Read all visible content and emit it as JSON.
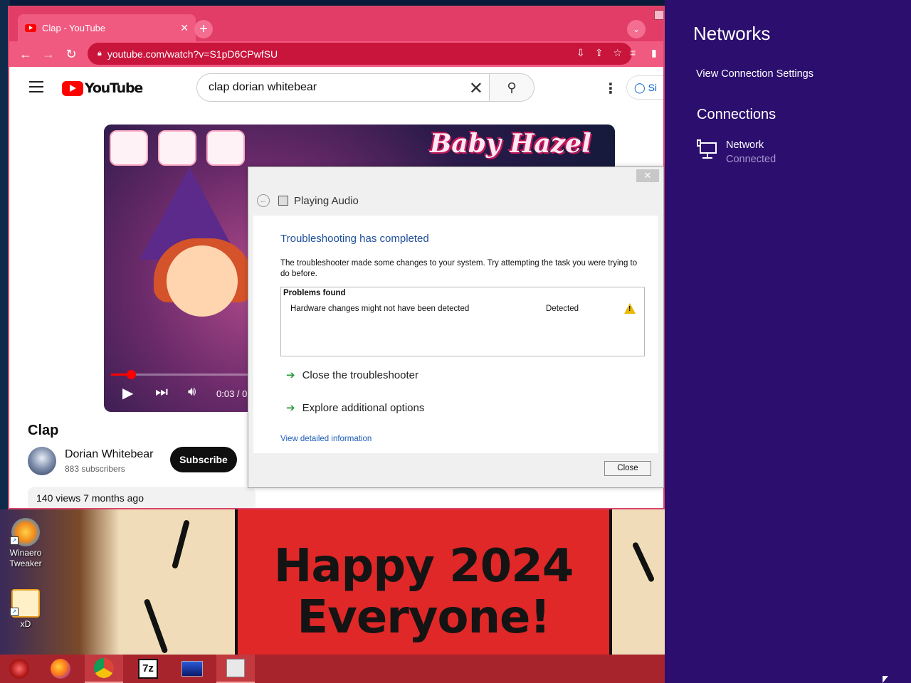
{
  "desktop": {
    "icons": [
      {
        "label_line1": "Winaero",
        "label_line2": "Tweaker"
      },
      {
        "label_line1": "xD",
        "label_line2": ""
      }
    ],
    "wallpaper_text_line1": "Happy 2024",
    "wallpaper_text_line2": "Everyone!"
  },
  "browser": {
    "tab_title": "Clap - YouTube",
    "tab_close": "✕",
    "new_tab": "+",
    "url": "youtube.com/watch?v=S1pD6CPwfSU",
    "youtube": {
      "logo_text": "YouTube",
      "search_value": "clap dorian whitebear",
      "signin_label": "Si",
      "player": {
        "game_title": "Baby Hazel",
        "time": "0:03 / 0"
      },
      "video_title": "Clap",
      "channel_name": "Dorian Whitebear",
      "subscribers": "883 subscribers",
      "subscribe_label": "Subscribe",
      "views": "140 views  7 months ago"
    }
  },
  "dialog": {
    "nav_title": "Playing Audio",
    "heading": "Troubleshooting has completed",
    "message": "The troubleshooter made some changes to your system. Try attempting the task you were trying to do before.",
    "problems_header": "Problems found",
    "problem_name": "Hardware changes might not have been detected",
    "problem_status": "Detected",
    "action_close": "Close the troubleshooter",
    "action_explore": "Explore additional options",
    "detail_link": "View detailed information",
    "close_button": "Close",
    "x_button": "✕"
  },
  "flyout": {
    "title": "Networks",
    "settings_link": "View Connection Settings",
    "section": "Connections",
    "network_name": "Network",
    "network_status": "Connected"
  },
  "colors": {
    "browser_accent": "#e23d66",
    "flyout_bg": "#2b0e6e",
    "taskbar": "#a8242c",
    "dialog_heading": "#1e4e9a"
  },
  "taskbar": {
    "items": [
      "start-orb",
      "firefox",
      "chrome",
      "7zip",
      "window",
      "troubleshooter"
    ],
    "active_items": [
      "chrome",
      "troubleshooter"
    ],
    "sevenzip_label": "7z"
  },
  "player_progress": 0.04
}
